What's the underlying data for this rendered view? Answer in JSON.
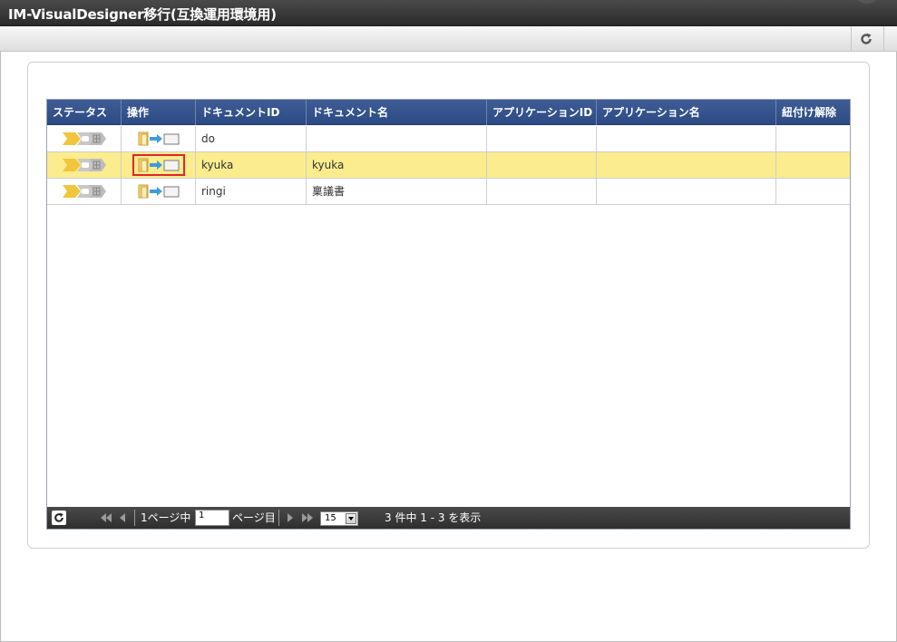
{
  "window": {
    "title": "IM-VisualDesigner移行(互換運用環境用)"
  },
  "toolbar": {
    "refresh_icon": "refresh-icon"
  },
  "grid": {
    "columns": [
      {
        "key": "status",
        "label": "ステータス"
      },
      {
        "key": "operation",
        "label": "操作"
      },
      {
        "key": "document_id",
        "label": "ドキュメントID"
      },
      {
        "key": "document_name",
        "label": "ドキュメント名"
      },
      {
        "key": "application_id",
        "label": "アプリケーションID"
      },
      {
        "key": "application_name",
        "label": "アプリケーション名"
      },
      {
        "key": "unlink",
        "label": "紐付け解除"
      }
    ],
    "rows": [
      {
        "document_id": "do",
        "document_name": "",
        "application_id": "",
        "application_name": "",
        "selected": false
      },
      {
        "document_id": "kyuka",
        "document_name": "kyuka",
        "application_id": "",
        "application_name": "",
        "selected": true
      },
      {
        "document_id": "ringi",
        "document_name": "稟議書",
        "application_id": "",
        "application_name": "",
        "selected": false
      }
    ],
    "status_icon": "status-progress-icon",
    "operation_icon": "migrate-document-icon",
    "selected_row_color": "#fbec8e",
    "header_color": "#2f4d87"
  },
  "pager": {
    "page_prefix": "1ページ中",
    "current_page": "1",
    "page_suffix": "ページ目",
    "page_size": "15",
    "summary": "3 件中 1 - 3 を表示"
  },
  "highlight": {
    "color": "#e0262a"
  }
}
